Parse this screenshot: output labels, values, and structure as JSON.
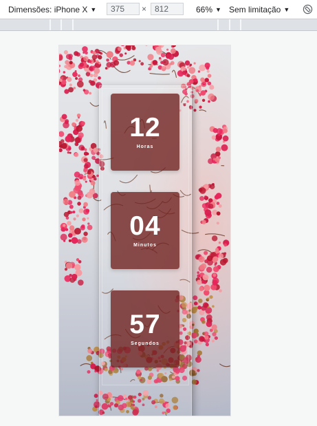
{
  "toolbar": {
    "device_label": "Dimensões: iPhone X",
    "width_value": "375",
    "times_symbol": "×",
    "height_value": "812",
    "zoom_label": "66%",
    "throttle_label": "Sem limitação",
    "caret": "▼",
    "rotate_icon": "rotate-icon"
  },
  "countdown": {
    "hours": {
      "value": "12",
      "label": "Horas"
    },
    "minutes": {
      "value": "04",
      "label": "Minutos"
    },
    "seconds": {
      "value": "57",
      "label": "Segundos"
    }
  },
  "colors": {
    "tile": "#6e201e",
    "flower_pink": "#e8245a",
    "flower_light": "#f07d86",
    "branch": "#6b3b2a",
    "leaf": "#a5752e"
  }
}
